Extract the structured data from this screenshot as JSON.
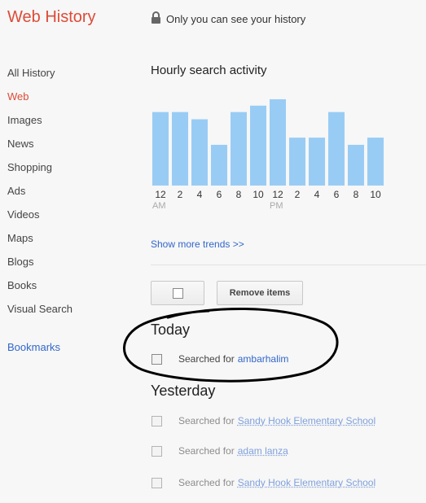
{
  "header": {
    "title": "Web History",
    "privacy_text": "Only you can see your history"
  },
  "sidebar": {
    "items": [
      {
        "label": "All History"
      },
      {
        "label": "Web"
      },
      {
        "label": "Images"
      },
      {
        "label": "News"
      },
      {
        "label": "Shopping"
      },
      {
        "label": "Ads"
      },
      {
        "label": "Videos"
      },
      {
        "label": "Maps"
      },
      {
        "label": "Blogs"
      },
      {
        "label": "Books"
      },
      {
        "label": "Visual Search"
      }
    ],
    "active_item": "Web",
    "bookmarks_label": "Bookmarks"
  },
  "chart": {
    "title": "Hourly search activity",
    "more_trends_label": "Show more trends >>"
  },
  "chart_data": {
    "type": "bar",
    "title": "Hourly search activity",
    "categories": [
      "12",
      "2",
      "4",
      "6",
      "8",
      "10",
      "12",
      "2",
      "4",
      "6",
      "8",
      "10"
    ],
    "sublabels": [
      "AM",
      "",
      "",
      "",
      "",
      "",
      "PM",
      "",
      "",
      "",
      "",
      ""
    ],
    "values": [
      92,
      92,
      83,
      51,
      92,
      100,
      108,
      60,
      60,
      92,
      51,
      60
    ],
    "ylim": [
      0,
      110
    ],
    "bar_color": "#99ccf5",
    "grid": false
  },
  "toolbar": {
    "remove_label": "Remove items"
  },
  "today": {
    "title": "Today",
    "entries": [
      {
        "prefix": "Searched for",
        "query": "ambarhalim"
      }
    ]
  },
  "yesterday": {
    "title": "Yesterday",
    "entries": [
      {
        "prefix": "Searched for",
        "query": "Sandy Hook Elementary School"
      },
      {
        "prefix": "Searched for",
        "query": "adam lanza"
      },
      {
        "prefix": "Searched for",
        "query": "Sandy Hook Elementary School"
      }
    ]
  },
  "colors": {
    "brand_red": "#dd4b39",
    "link_blue": "#3366cc",
    "bar_blue": "#99ccf5",
    "annotation_circle": "#000000"
  }
}
